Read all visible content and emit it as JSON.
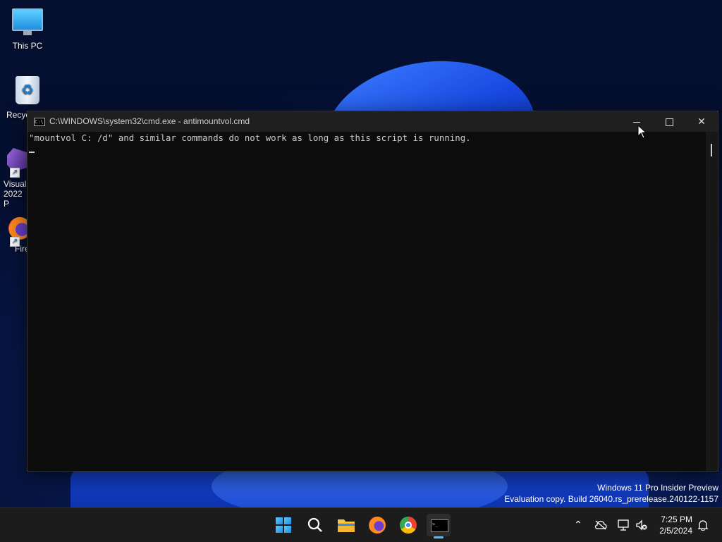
{
  "desktop": {
    "icons": [
      {
        "label": "This PC"
      },
      {
        "label": "Recyc"
      },
      {
        "label_line1": "Visual",
        "label_line2": "2022 P"
      },
      {
        "label": "Fire"
      }
    ]
  },
  "window": {
    "title": "C:\\WINDOWS\\system32\\cmd.exe - antimountvol.cmd",
    "output_line": "\"mountvol C: /d\" and similar commands do not work as long as this script is running."
  },
  "watermark": {
    "line1": "Windows 11 Pro Insider Preview",
    "line2": "Evaluation copy. Build 26040.rs_prerelease.240122-1157"
  },
  "taskbar": {
    "time": "7:25 PM",
    "date": "2/5/2024"
  },
  "colors": {
    "accent": "#4cc2ff",
    "console_bg": "#0c0c0c",
    "console_text": "#cccccc",
    "taskbar_bg": "#1c1c1c"
  }
}
